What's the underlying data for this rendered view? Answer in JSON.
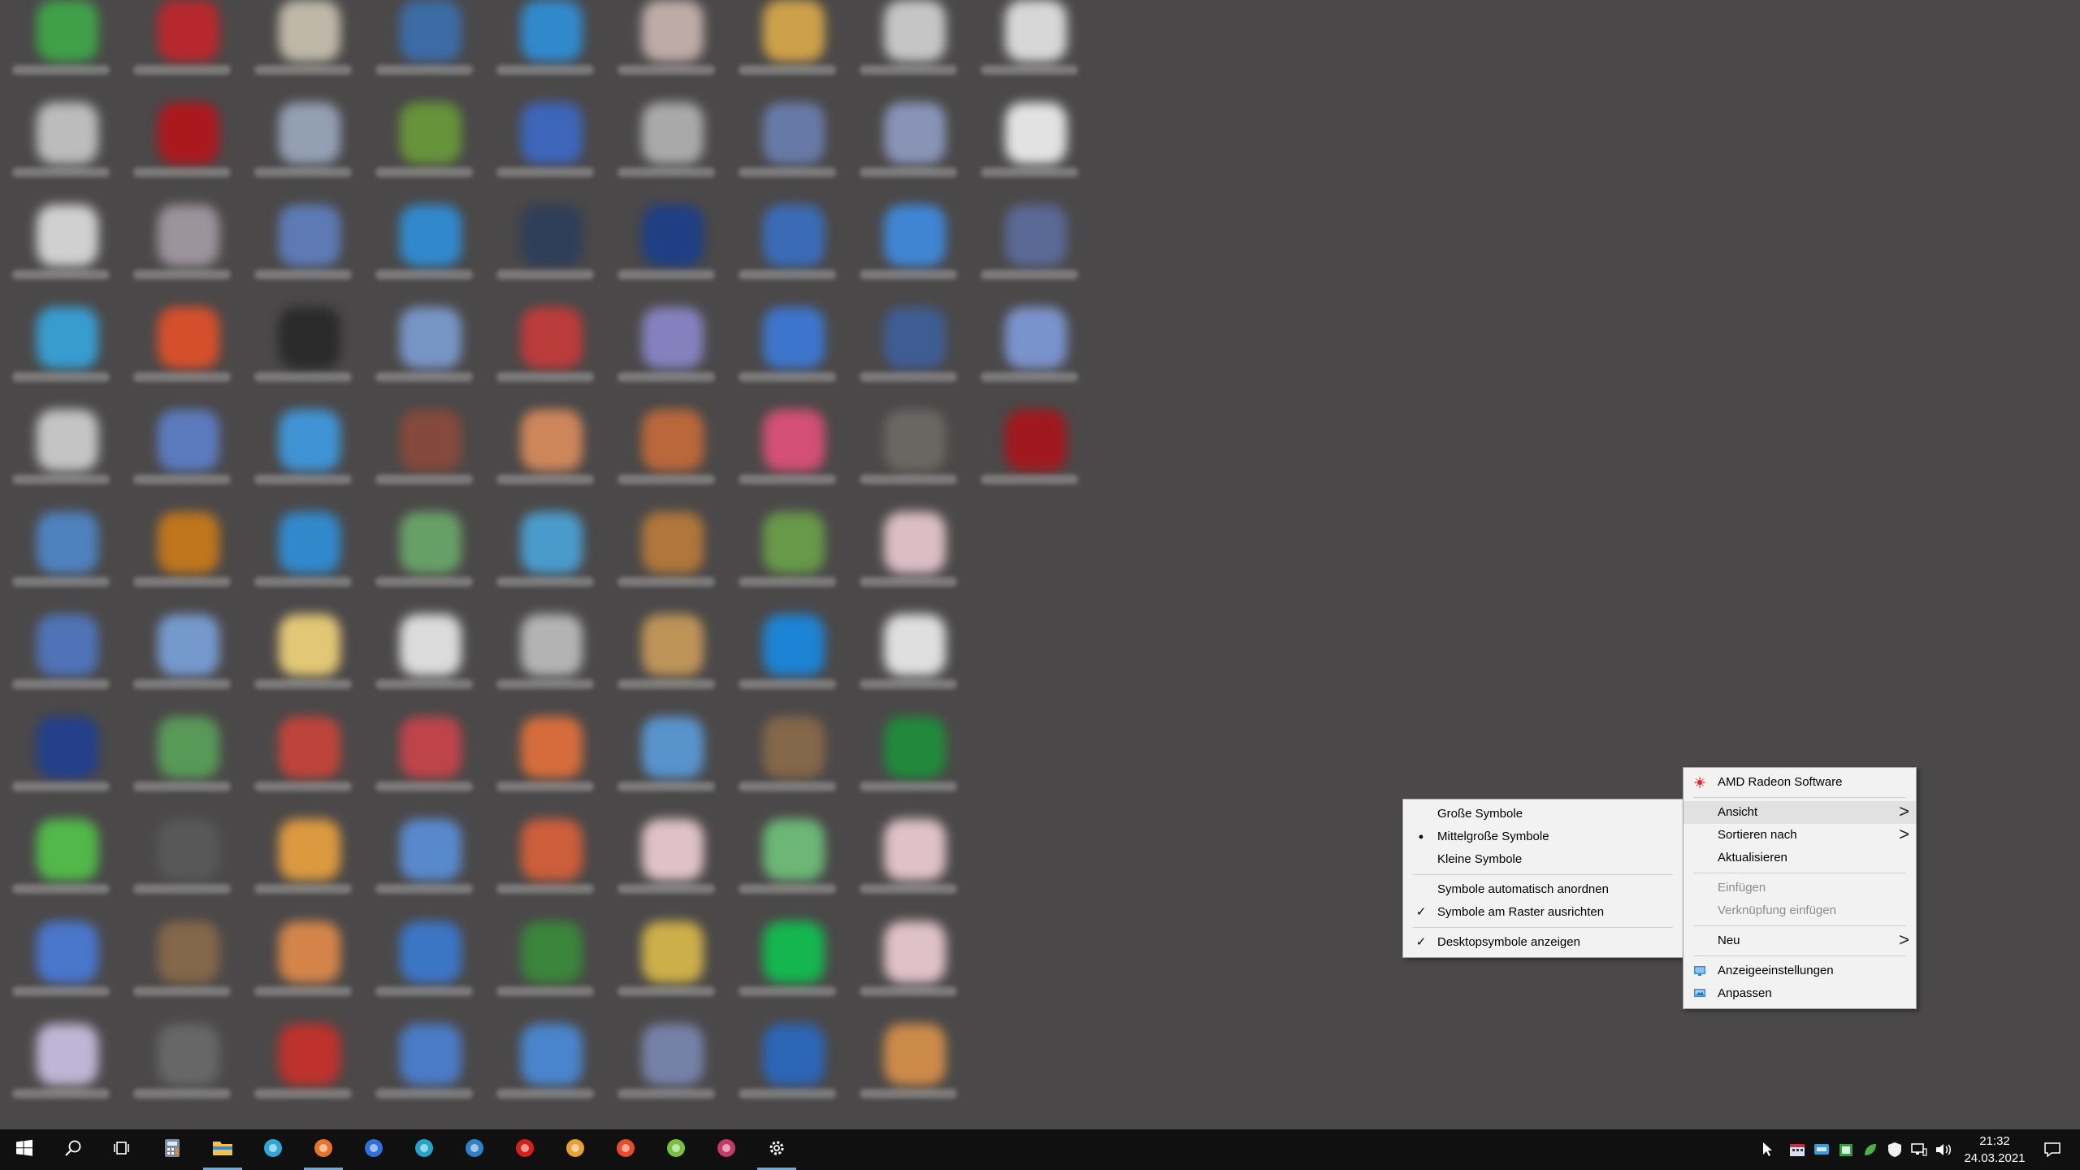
{
  "desktop": {
    "icons": [
      {
        "color": "#3fa84a"
      },
      {
        "color": "#c0262b"
      },
      {
        "color": "#c9c2b2"
      },
      {
        "color": "#3b6fae"
      },
      {
        "color": "#2f8fd8"
      },
      {
        "color": "#c8b4b0"
      },
      {
        "color": "#d9a94a"
      },
      {
        "color": "#d0d0d0"
      },
      {
        "color": "#e4e4e4"
      },
      {
        "color": "#c6c6c6"
      },
      {
        "color": "#b3141b"
      },
      {
        "color": "#9aa7bd"
      },
      {
        "color": "#6a9a3a"
      },
      {
        "color": "#3c68c4"
      },
      {
        "color": "#b2b2b2"
      },
      {
        "color": "#6a7fb0"
      },
      {
        "color": "#8e9ac0"
      },
      {
        "color": "#f0f0f0"
      },
      {
        "color": "#dcdcdc"
      },
      {
        "color": "#a39aa3"
      },
      {
        "color": "#5f7fbf"
      },
      {
        "color": "#2f8fd8"
      },
      {
        "color": "#2c3e5a"
      },
      {
        "color": "#1c3e8a"
      },
      {
        "color": "#3a6fc0"
      },
      {
        "color": "#3f8be0"
      },
      {
        "color": "#5c6c9c"
      },
      {
        "color": "#37a4dc"
      },
      {
        "color": "#e2502a"
      },
      {
        "color": "#282828"
      },
      {
        "color": "#7b9cd0"
      },
      {
        "color": "#c63a3a"
      },
      {
        "color": "#8a86c8"
      },
      {
        "color": "#3d79d8"
      },
      {
        "color": "#3e5f9a"
      },
      {
        "color": "#7f9ad8"
      },
      {
        "color": "#cfcfcf"
      },
      {
        "color": "#5d7fc8"
      },
      {
        "color": "#3f9ae0"
      },
      {
        "color": "#8a4a3a"
      },
      {
        "color": "#d98b5c"
      },
      {
        "color": "#c46a3a"
      },
      {
        "color": "#e0507a"
      },
      {
        "color": "#6d6a66"
      },
      {
        "color": "#a8151b"
      },
      {
        "color": "#4f87c8"
      },
      {
        "color": "#c97a1a"
      },
      {
        "color": "#2f8fd8"
      },
      {
        "color": "#6aa86a"
      },
      {
        "color": "#4aa3d8"
      },
      {
        "color": "#b97a3a"
      },
      {
        "color": "#6aa04a"
      },
      {
        "color": "#e8c8d0"
      },
      {
        "color": "#5077c0"
      },
      {
        "color": "#7aa0d8"
      },
      {
        "color": "#efd27a"
      },
      {
        "color": "#e8e8e8"
      },
      {
        "color": "#bdbdbd"
      },
      {
        "color": "#c89a5a"
      },
      {
        "color": "#1a88e0"
      },
      {
        "color": "#ececec"
      },
      {
        "color": "#203f90"
      },
      {
        "color": "#5aa05a"
      },
      {
        "color": "#c8443a"
      },
      {
        "color": "#c8444a"
      },
      {
        "color": "#e2703a"
      },
      {
        "color": "#5a9ad8"
      },
      {
        "color": "#8a6a4a"
      },
      {
        "color": "#1e8f3a"
      },
      {
        "color": "#52c24a"
      },
      {
        "color": "#5a5a5a"
      },
      {
        "color": "#e8a040"
      },
      {
        "color": "#5a8fd8"
      },
      {
        "color": "#d8603a"
      },
      {
        "color": "#ecccd4"
      },
      {
        "color": "#6fc07a"
      },
      {
        "color": "#ecccd4"
      },
      {
        "color": "#4a7ad8"
      },
      {
        "color": "#8a6a4a"
      },
      {
        "color": "#e08a4a"
      },
      {
        "color": "#3a7ad0"
      },
      {
        "color": "#3a8a3a"
      },
      {
        "color": "#d8b84a"
      },
      {
        "color": "#10c050"
      },
      {
        "color": "#ecccd4"
      },
      {
        "color": "#c8c0e0"
      },
      {
        "color": "#6a6a6a"
      },
      {
        "color": "#c8302a"
      },
      {
        "color": "#4a80d0"
      },
      {
        "color": "#4a8ad8"
      },
      {
        "color": "#7a86b0"
      },
      {
        "color": "#2a68c0"
      },
      {
        "color": "#d8904a"
      }
    ]
  },
  "view_menu": {
    "items": [
      {
        "label": "Große Symbole",
        "mark": ""
      },
      {
        "label": "Mittelgroße Symbole",
        "mark": "●"
      },
      {
        "label": "Kleine Symbole",
        "mark": ""
      },
      {
        "label": "Symbole automatisch anordnen",
        "mark": ""
      },
      {
        "label": "Symbole am Raster ausrichten",
        "mark": "✓"
      },
      {
        "label": "Desktopsymbole anzeigen",
        "mark": "✓"
      }
    ]
  },
  "context_menu": {
    "amd": "AMD Radeon Software",
    "ansicht": "Ansicht",
    "sortieren": "Sortieren nach",
    "aktualisieren": "Aktualisieren",
    "einfuegen": "Einfügen",
    "verknuepfung": "Verknüpfung einfügen",
    "neu": "Neu",
    "anzeige": "Anzeigeeinstellungen",
    "anpassen": "Anpassen",
    "submenu_arrow": ">"
  },
  "taskbar": {
    "apps": [
      {
        "name": "start-icon",
        "color": "#ffffff"
      },
      {
        "name": "search-icon",
        "color": "#ffffff"
      },
      {
        "name": "task-view-icon",
        "color": "#ffffff"
      },
      {
        "name": "calculator-icon",
        "color": "#7a8aa0"
      },
      {
        "name": "file-explorer-icon",
        "color": "#f2c34a"
      },
      {
        "name": "edge-icon",
        "color": "#2fa8d8"
      },
      {
        "name": "firefox-icon",
        "color": "#e8742a"
      },
      {
        "name": "mail-icon",
        "color": "#2f6fd8"
      },
      {
        "name": "app-q-icon",
        "color": "#25a4c8"
      },
      {
        "name": "app-grid-icon",
        "color": "#2f80c8"
      },
      {
        "name": "acrobat-icon",
        "color": "#d4201a"
      },
      {
        "name": "crown-app-icon",
        "color": "#e8a030"
      },
      {
        "name": "pinwheel-app-icon",
        "color": "#e84a2a"
      },
      {
        "name": "android-app-icon",
        "color": "#7ac040"
      },
      {
        "name": "film-app-icon",
        "color": "#c03a6a"
      },
      {
        "name": "settings-icon",
        "color": "#ffffff"
      }
    ],
    "clock_time": "21:32",
    "clock_date": "24.03.2021"
  }
}
